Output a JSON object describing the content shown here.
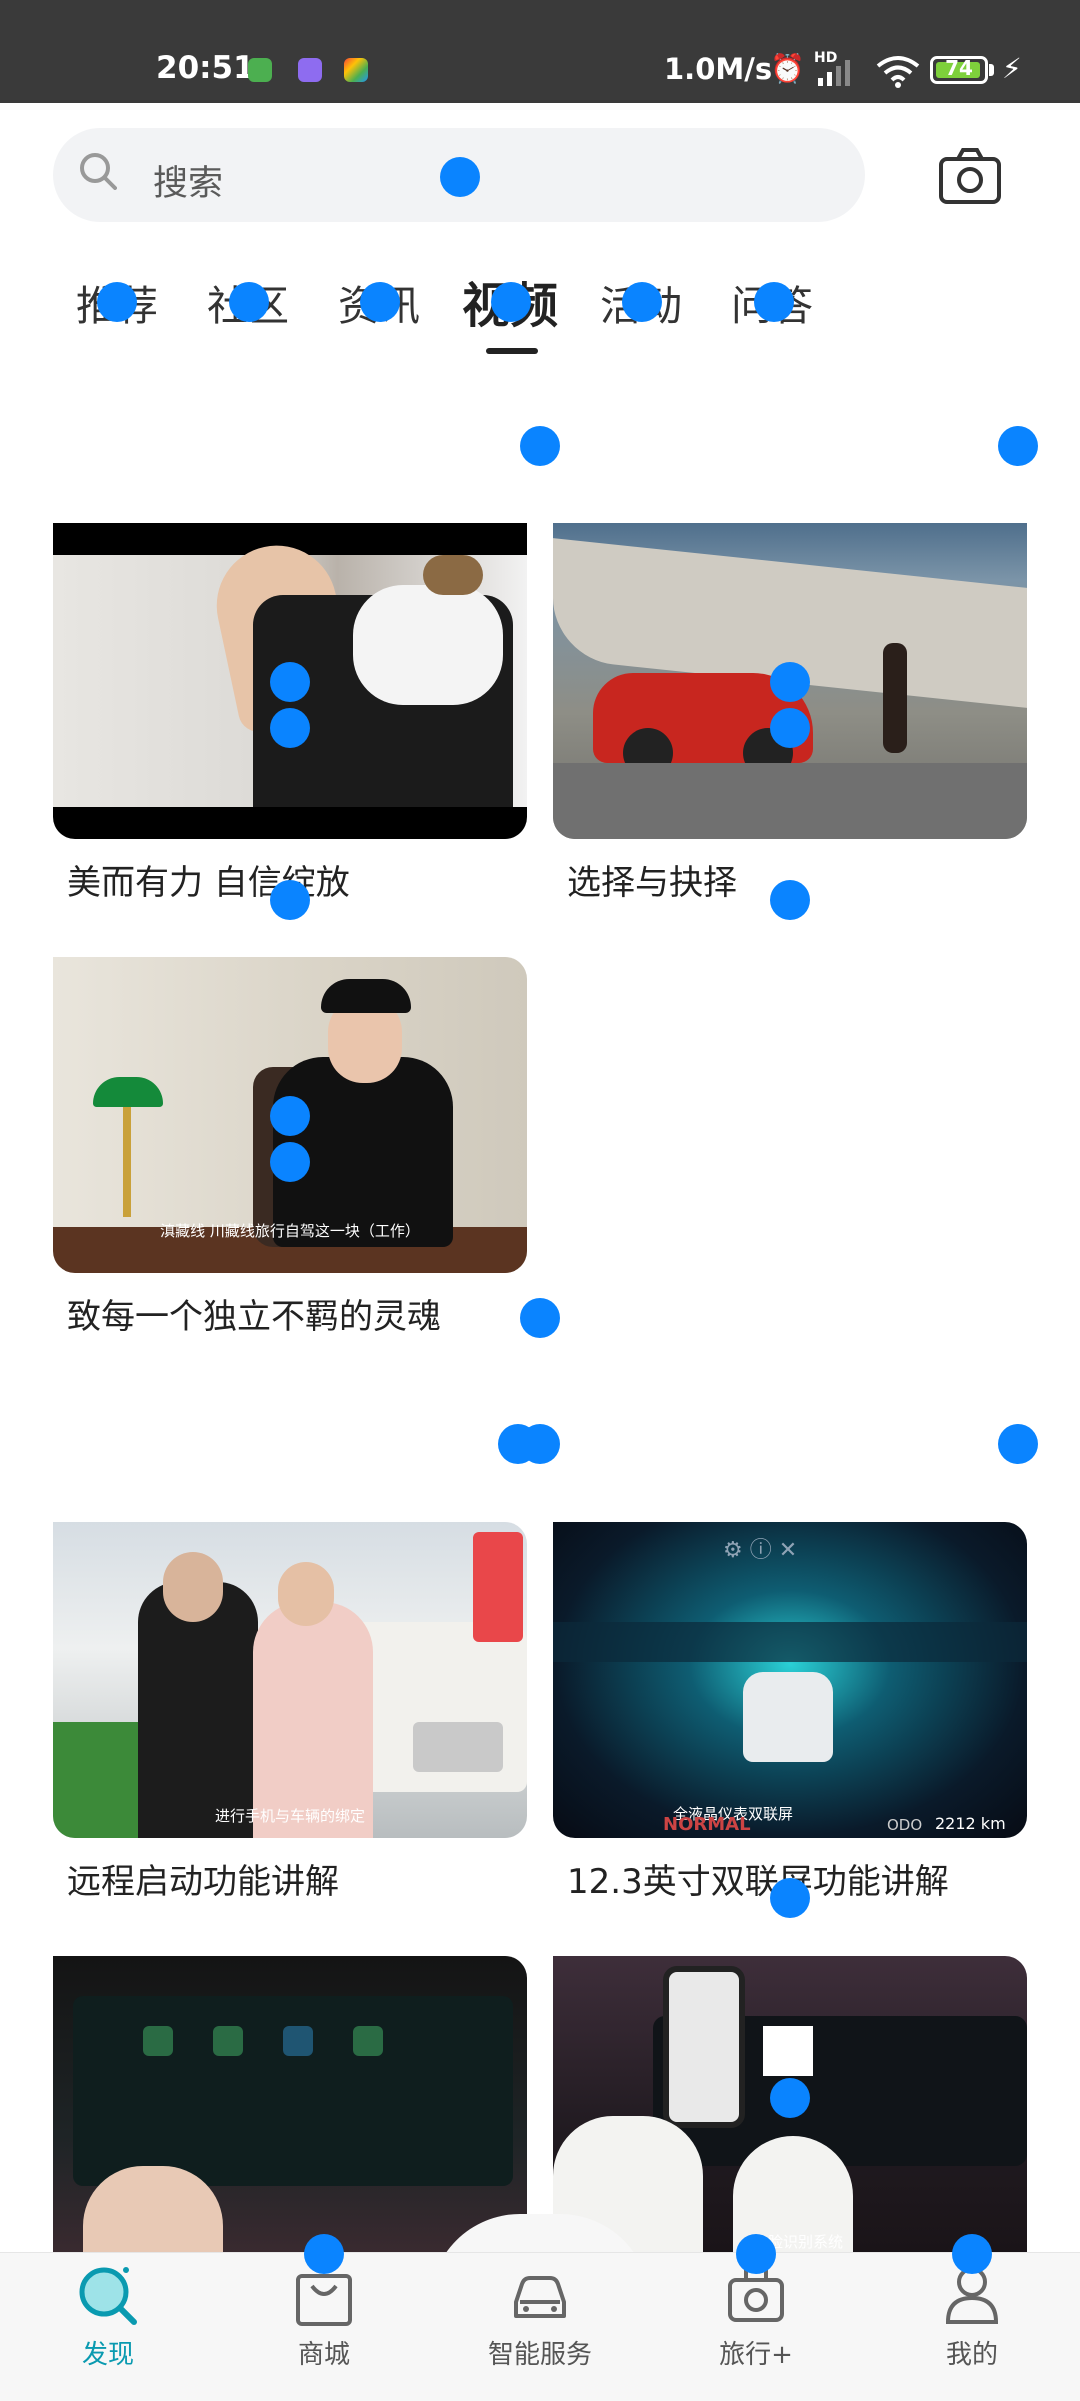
{
  "status_bar": {
    "time": "20:51",
    "network_speed": "1.0M/s",
    "network_type": "HD",
    "battery_level": "74"
  },
  "search": {
    "placeholder": "搜索",
    "icon": "search-icon",
    "camera_icon": "camera-icon"
  },
  "tabs": [
    {
      "label": "推荐",
      "active": false
    },
    {
      "label": "社区",
      "active": false
    },
    {
      "label": "资讯",
      "active": false
    },
    {
      "label": "视频",
      "active": true
    },
    {
      "label": "活动",
      "active": false
    },
    {
      "label": "问答",
      "active": false
    }
  ],
  "videos": [
    {
      "title": "美而有力 自信绽放",
      "caption": ""
    },
    {
      "title": "选择与抉择",
      "caption": ""
    },
    {
      "title": "致每一个独立不羁的灵魂",
      "caption": "滇藏线 川藏线旅行自驾这一块（工作）"
    },
    {
      "title": "远程启动功能讲解",
      "caption": "进行手机与车辆的绑定"
    },
    {
      "title": "12.3英寸双联屏功能讲解",
      "caption": "全液晶仪表双联屏"
    },
    {
      "title": "",
      "caption": ""
    },
    {
      "title": "",
      "caption": "人脸识别系统"
    }
  ],
  "dash_overlay": {
    "mode": "NORMAL",
    "odo_label": "ODO",
    "odo_value": "2212 km"
  },
  "bottom_nav": [
    {
      "label": "发现",
      "icon": "discover-icon",
      "active": true
    },
    {
      "label": "商城",
      "icon": "shopping-bag-icon",
      "active": false
    },
    {
      "label": "智能服务",
      "icon": "car-icon",
      "active": false
    },
    {
      "label": "旅行+",
      "icon": "travel-camera-icon",
      "active": false
    },
    {
      "label": "我的",
      "icon": "profile-icon",
      "active": false
    }
  ],
  "colors": {
    "accent": "#0a9ab0",
    "marker": "#0a84ff",
    "status_bar": "#3a3a3a"
  }
}
